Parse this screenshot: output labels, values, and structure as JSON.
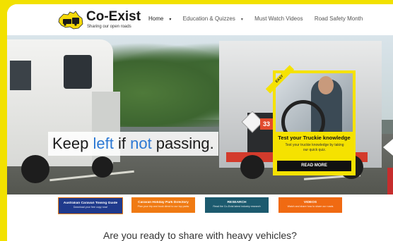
{
  "header": {
    "logo_title": "Co-Exist",
    "logo_tagline": "Sharing our open roads",
    "nav": [
      {
        "label": "Home",
        "dropdown": true
      },
      {
        "label": "Education & Quizzes",
        "dropdown": true
      },
      {
        "label": "Must Watch Videos",
        "dropdown": false
      },
      {
        "label": "Road Safety Month",
        "dropdown": false
      }
    ]
  },
  "hero": {
    "slogan_part1": "Keep ",
    "slogan_left": "left",
    "slogan_part2": " if ",
    "slogan_not": "not",
    "slogan_part3": " passing.",
    "accent_color": "#2b78d4",
    "carousel_controls": "▸ ○ ● ○ ○ ○ ॥",
    "plate_number": "33"
  },
  "quiz_card": {
    "ribbon": "EASY",
    "title": "Test your Truckie knowledge",
    "text": "Test your truckie knowledge by taking our quick quiz.",
    "button": "READ MORE",
    "background": "#f5e200"
  },
  "promos": [
    {
      "title": "Australian Caravan Towing Guide",
      "subtitle": "Download your free copy now!",
      "color": "#1f3a8c"
    },
    {
      "title": "Caravan Holiday Park Directory",
      "subtitle": "Plan your trip and book direct to our top parks",
      "color": "#f07a12"
    },
    {
      "title": "RESEARCH",
      "subtitle": "Read the Co-Exist latest industry research",
      "color": "#1c5a6e"
    },
    {
      "title": "VIDEOS",
      "subtitle": "Watch and share how to share our roads",
      "color": "#f06a12"
    }
  ],
  "bottom_heading": "Are you ready to share with heavy vehicles?"
}
